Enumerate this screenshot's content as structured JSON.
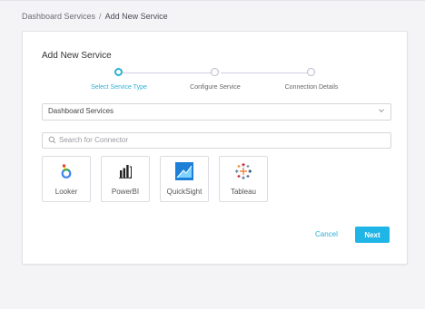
{
  "breadcrumb": {
    "parent": "Dashboard Services",
    "separator": "/",
    "current": "Add New Service"
  },
  "card": {
    "title": "Add New Service"
  },
  "steps": [
    {
      "label": "Select Service Type",
      "active": true
    },
    {
      "label": "Configure Service",
      "active": false
    },
    {
      "label": "Connection Details",
      "active": false
    }
  ],
  "service_select": {
    "value": "Dashboard Services"
  },
  "search": {
    "placeholder": "Search for Connector",
    "value": ""
  },
  "connectors": [
    {
      "name": "Looker",
      "icon": "looker-icon"
    },
    {
      "name": "PowerBI",
      "icon": "powerbi-icon"
    },
    {
      "name": "QuickSight",
      "icon": "quicksight-icon"
    },
    {
      "name": "Tableau",
      "icon": "tableau-icon"
    }
  ],
  "actions": {
    "cancel_label": "Cancel",
    "next_label": "Next"
  },
  "colors": {
    "accent": "#2bb0d6",
    "primary_button": "#1fb5e6",
    "background": "#f4f4f6"
  }
}
